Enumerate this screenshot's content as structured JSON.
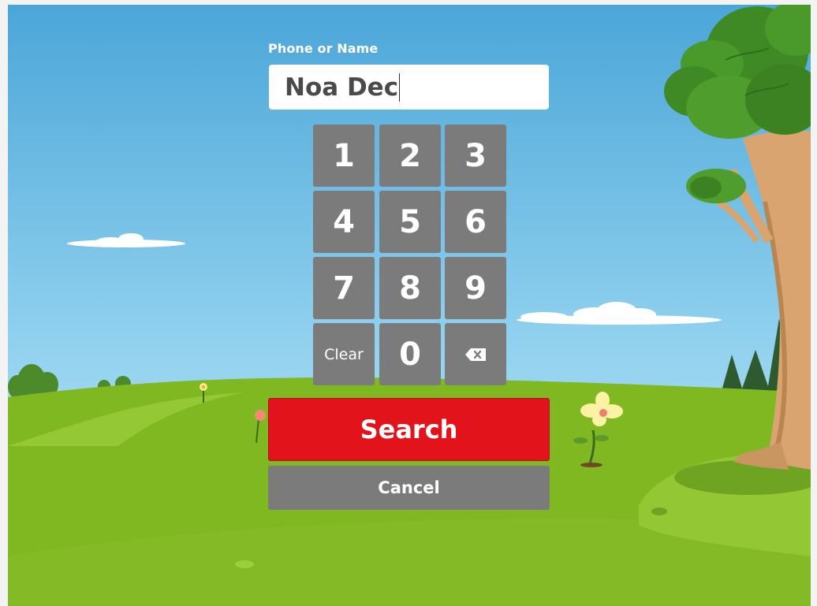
{
  "form": {
    "label": "Phone or Name",
    "input_value": "Noa Dec"
  },
  "keypad": {
    "keys": [
      "1",
      "2",
      "3",
      "4",
      "5",
      "6",
      "7",
      "8",
      "9",
      "Clear",
      "0",
      "backspace"
    ],
    "clear_label": "Clear",
    "backspace_icon": "backspace-icon"
  },
  "actions": {
    "search_label": "Search",
    "cancel_label": "Cancel"
  },
  "colors": {
    "sky_top": "#4ba6d8",
    "sky_bottom": "#b9e2f3",
    "grass": "#80b822",
    "key_gray": "#7c7b7c",
    "search_red": "#e3131b",
    "cancel_gray": "#7b7b7b"
  }
}
